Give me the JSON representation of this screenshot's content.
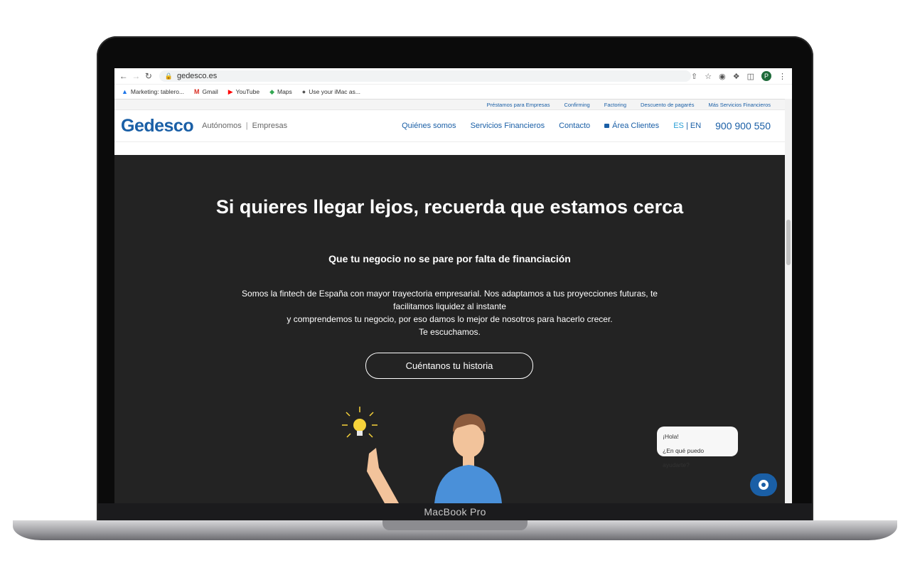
{
  "browser": {
    "url": "gedesco.es",
    "bookmarks": [
      {
        "label": "Marketing: tablero...",
        "icon": "triangle-icon"
      },
      {
        "label": "Gmail",
        "icon": "gmail-icon"
      },
      {
        "label": "YouTube",
        "icon": "youtube-icon"
      },
      {
        "label": "Maps",
        "icon": "maps-icon"
      },
      {
        "label": "Use your iMac as...",
        "icon": "apple-icon"
      }
    ],
    "profile_initial": "P"
  },
  "topbar": {
    "links": [
      "Préstamos para Empresas",
      "Confirming",
      "Factoring",
      "Descuento de pagarés",
      "Más Servicios Financieros"
    ]
  },
  "header": {
    "logo": "Gedesco",
    "tag_a": "Autónomos",
    "tag_sep": "|",
    "tag_b": "Empresas",
    "menu": [
      "Quiénes somos",
      "Servicios Financieros",
      "Contacto"
    ],
    "area_clientes": "Área Clientes",
    "lang_es": "ES",
    "lang_sep": "|",
    "lang_en": "EN",
    "phone": "900 900 550"
  },
  "hero": {
    "title": "Si quieres llegar lejos, recuerda que estamos cerca",
    "subtitle": "Que tu negocio no se pare por falta de financiación",
    "p1": "Somos la fintech de España con mayor trayectoria empresarial. Nos adaptamos a tus proyecciones futuras, te facilitamos liquidez al instante",
    "p2": "y comprendemos tu negocio, por eso damos lo mejor de nosotros para hacerlo crecer.",
    "p3": "Te escuchamos.",
    "cta": "Cuéntanos tu historia"
  },
  "chat": {
    "line1": "¡Hola!",
    "line2": "¿En qué puedo ayudarte?"
  },
  "device": {
    "label": "MacBook Pro"
  }
}
